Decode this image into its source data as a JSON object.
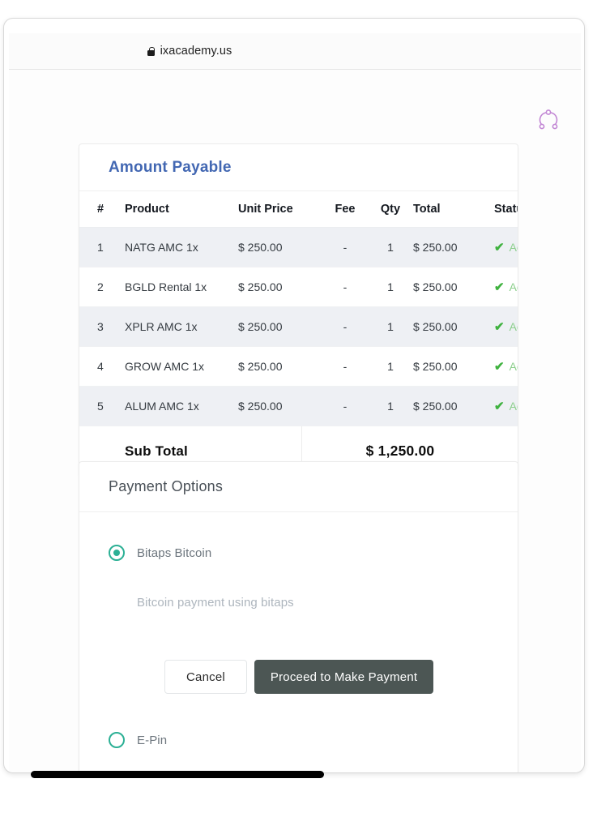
{
  "browser": {
    "url": "ixacademy.us",
    "lock_icon": "lock-icon"
  },
  "page": {
    "network_icon": "share-network-icon"
  },
  "amount_payable": {
    "title": "Amount Payable",
    "columns": [
      "#",
      "Product",
      "Unit Price",
      "Fee",
      "Qty",
      "Total",
      "Status"
    ],
    "rows": [
      {
        "num": "1",
        "product": "NATG AMC 1x",
        "unit_price": "$ 250.00",
        "fee": "-",
        "qty": "1",
        "total": "$ 250.00",
        "status": "Activ"
      },
      {
        "num": "2",
        "product": "BGLD Rental 1x",
        "unit_price": "$ 250.00",
        "fee": "-",
        "qty": "1",
        "total": "$ 250.00",
        "status": "Activ"
      },
      {
        "num": "3",
        "product": "XPLR AMC 1x",
        "unit_price": "$ 250.00",
        "fee": "-",
        "qty": "1",
        "total": "$ 250.00",
        "status": "Activ"
      },
      {
        "num": "4",
        "product": "GROW AMC 1x",
        "unit_price": "$ 250.00",
        "fee": "-",
        "qty": "1",
        "total": "$ 250.00",
        "status": "Activ"
      },
      {
        "num": "5",
        "product": "ALUM AMC 1x",
        "unit_price": "$ 250.00",
        "fee": "-",
        "qty": "1",
        "total": "$ 250.00",
        "status": "Activ"
      }
    ],
    "subtotal_label": "Sub Total",
    "subtotal_value": "$ 1,250.00",
    "check_glyph": "✔"
  },
  "payment_options": {
    "title": "Payment Options",
    "options": [
      {
        "label": "Bitaps Bitcoin",
        "selected": true,
        "description": "Bitcoin payment using bitaps"
      },
      {
        "label": "E-Pin",
        "selected": false,
        "description": ""
      }
    ],
    "cancel_label": "Cancel",
    "proceed_label": "Proceed to Make Payment"
  },
  "colors": {
    "title_blue": "#4267b2",
    "radio_teal": "#2cb095",
    "status_green": "#3fb23f",
    "proceed_dark": "#4c5654",
    "network_icon_purple": "#c287d4"
  }
}
